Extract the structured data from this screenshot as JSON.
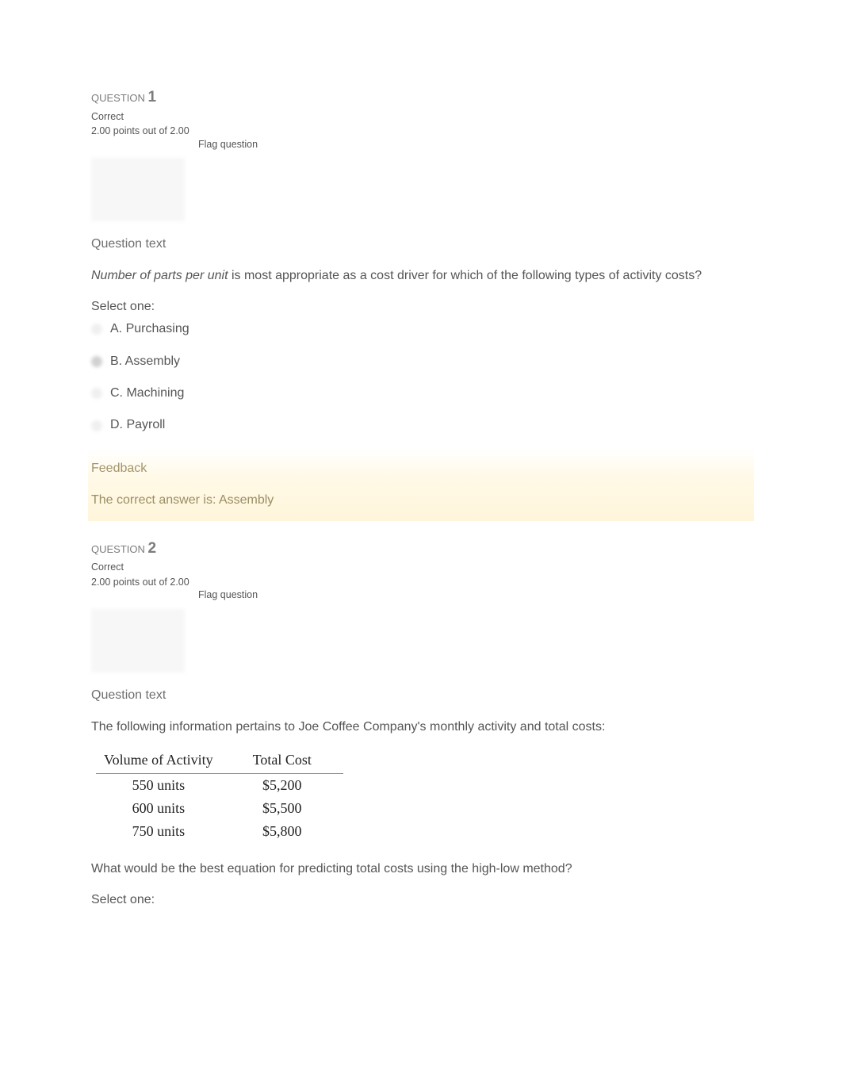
{
  "q1": {
    "label_prefix": "QUESTION ",
    "number": "1",
    "status": "Correct",
    "points": "2.00 points out of 2.00",
    "flag": "Flag question",
    "section_heading": "Question text",
    "prompt_italic": "Number of parts per unit",
    "prompt_rest": " is most appropriate as a cost driver for which of the following types of activity costs?",
    "select_one": "Select one:",
    "options": {
      "a": "A. Purchasing",
      "b": "B. Assembly",
      "c": "C. Machining",
      "d": "D. Payroll"
    },
    "feedback_heading": "Feedback",
    "feedback_answer": "The correct answer is: Assembly"
  },
  "q2": {
    "label_prefix": "QUESTION ",
    "number": "2",
    "status": "Correct",
    "points": "2.00 points out of 2.00",
    "flag": "Flag question",
    "section_heading": "Question text",
    "prompt": "The following information pertains to Joe Coffee Company's monthly activity and total costs:",
    "table": {
      "header_vol": "Volume of Activity",
      "header_cost": "Total Cost",
      "rows": [
        {
          "vol": "550 units",
          "cost": "$5,200"
        },
        {
          "vol": "600 units",
          "cost": "$5,500"
        },
        {
          "vol": "750 units",
          "cost": "$5,800"
        }
      ]
    },
    "prompt2": "What would be the best equation for predicting total costs using the high-low method?",
    "select_one": "Select one:"
  }
}
